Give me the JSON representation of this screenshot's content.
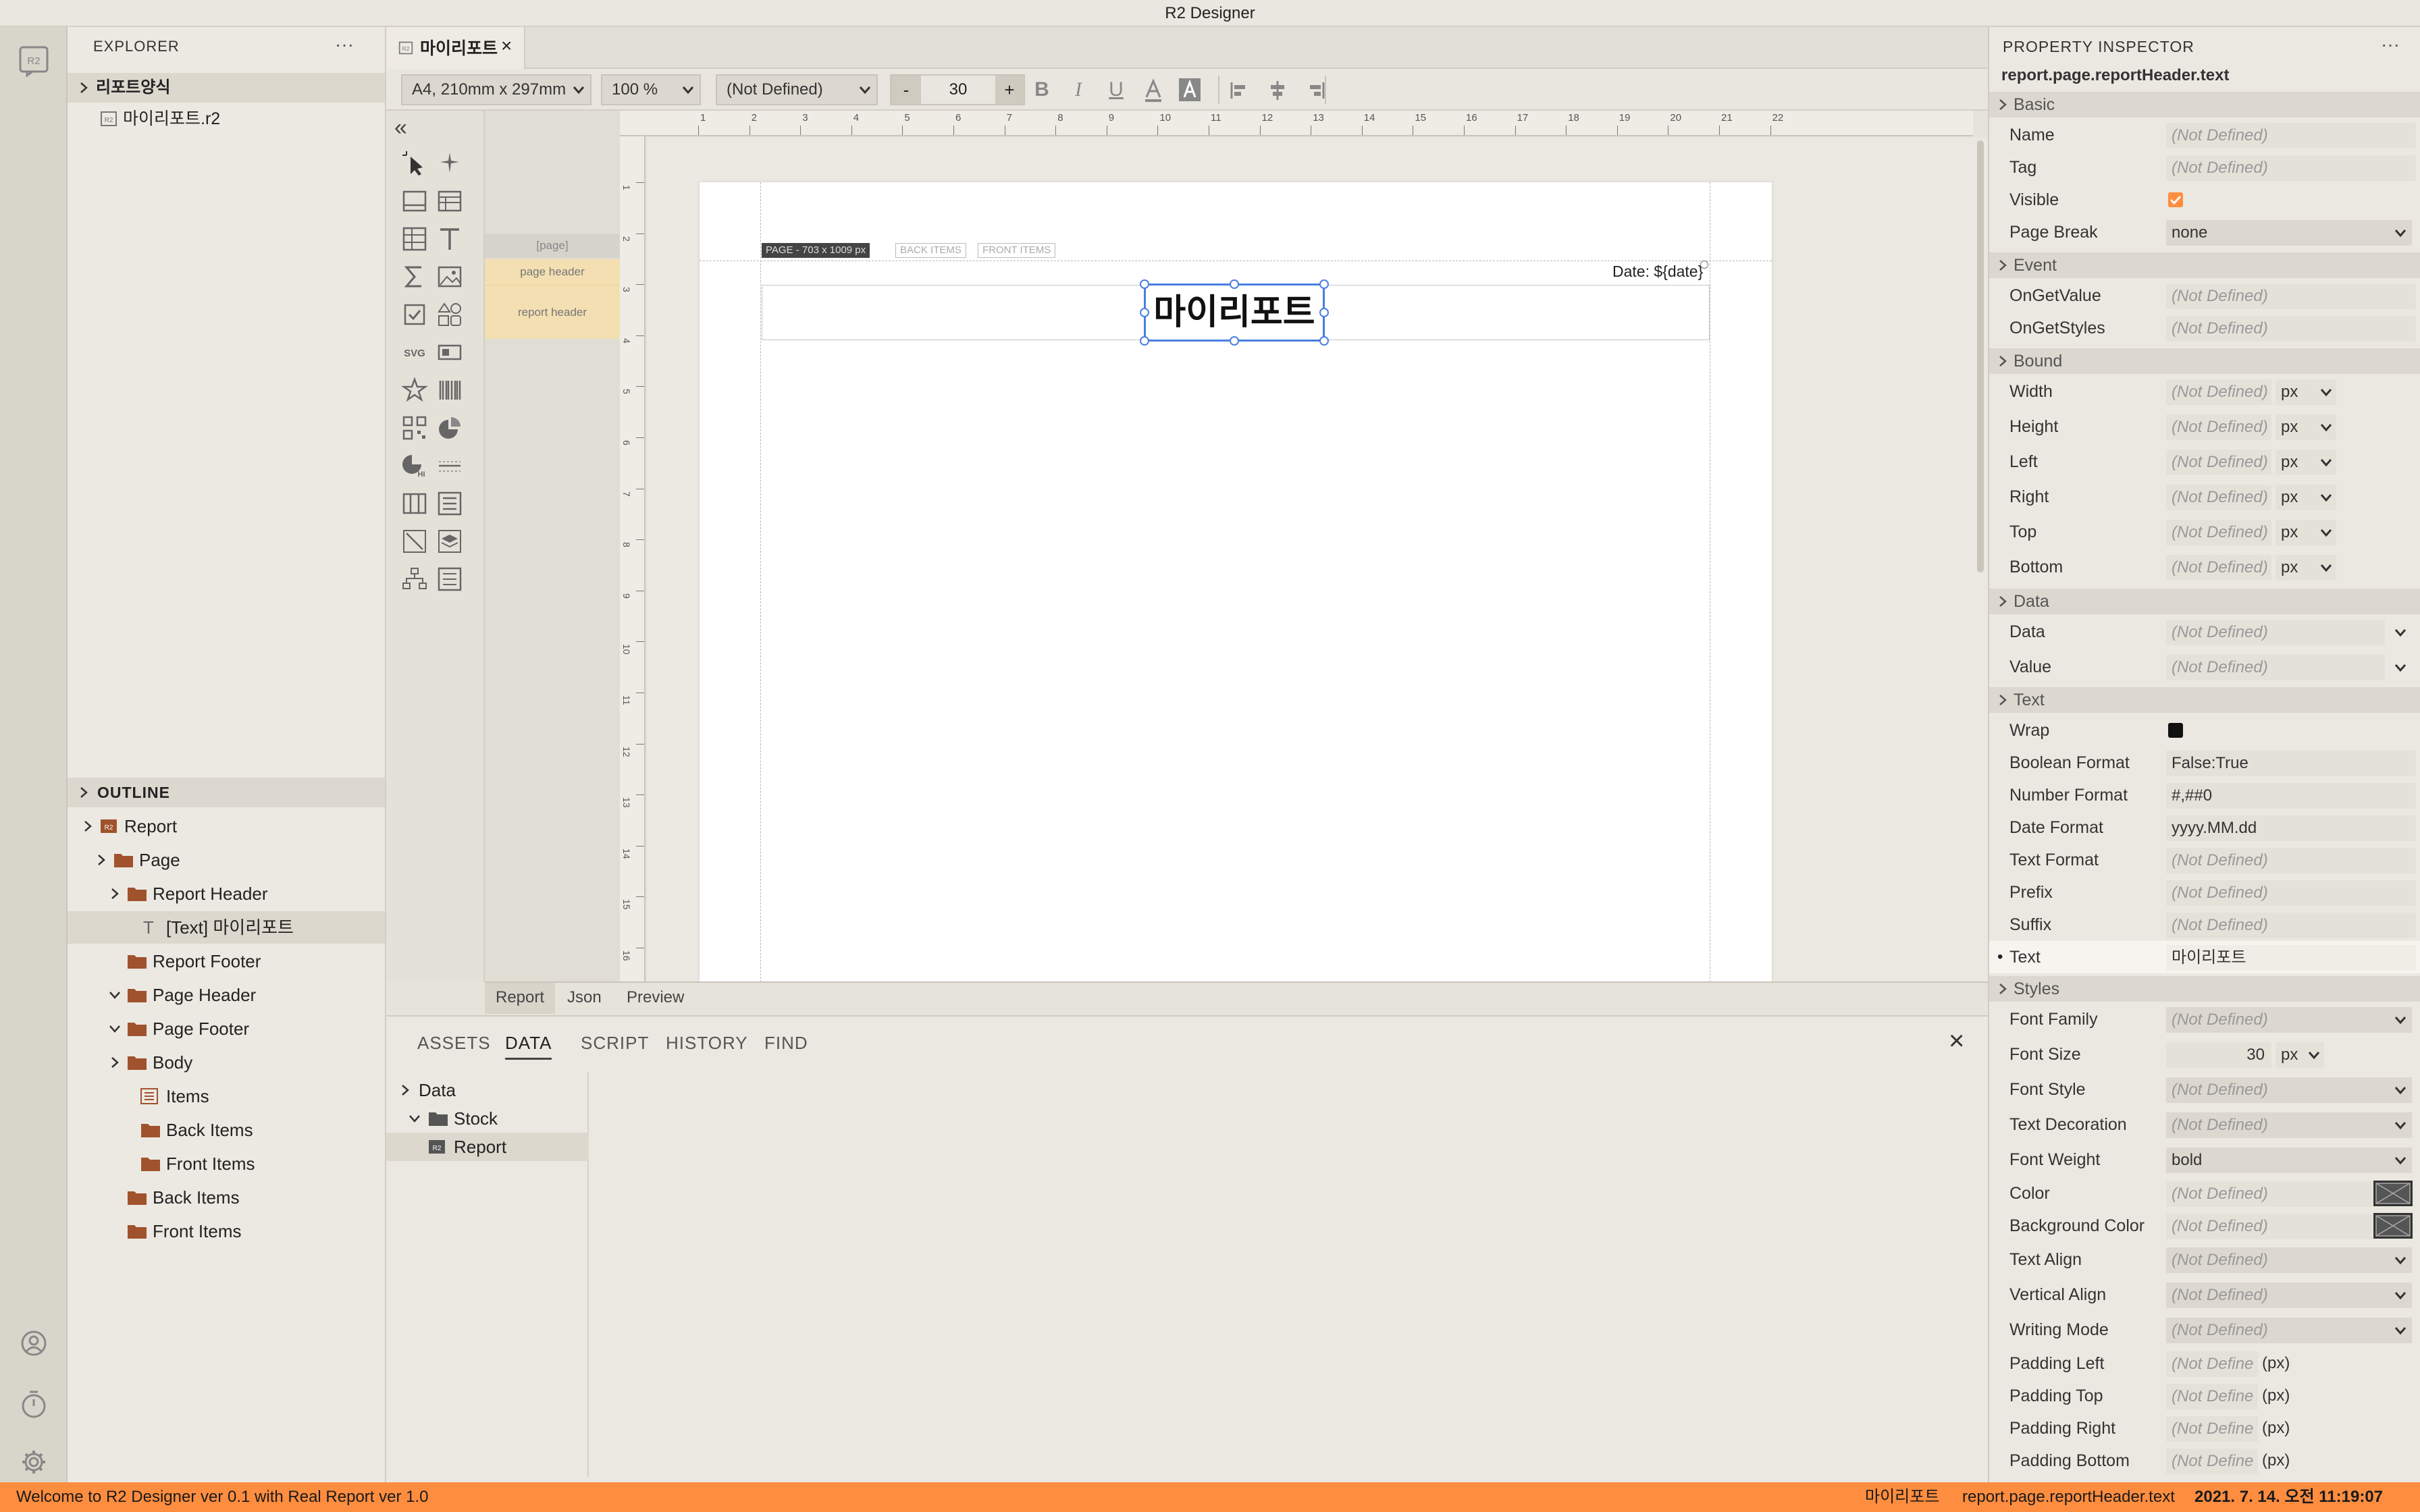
{
  "window": {
    "title": "R2 Designer"
  },
  "explorer": {
    "title": "EXPLORER",
    "more": "···",
    "folder": "리포트양식",
    "file": "마이리포트.r2"
  },
  "outline": {
    "title": "OUTLINE",
    "items": [
      {
        "label": "Report"
      },
      {
        "label": "Page"
      },
      {
        "label": "Report Header"
      },
      {
        "label": "[Text] 마이리포트"
      },
      {
        "label": "Report Footer"
      },
      {
        "label": "Page Header"
      },
      {
        "label": "Page Footer"
      },
      {
        "label": "Body"
      },
      {
        "label": "Items"
      },
      {
        "label": "Back Items"
      },
      {
        "label": "Front Items"
      },
      {
        "label": "Back Items"
      },
      {
        "label": "Front Items"
      }
    ]
  },
  "editor": {
    "tab_label": "마이리포트",
    "tab_close": "×",
    "collapse": "«"
  },
  "toolbar": {
    "paper": "A4, 210mm x 297mm",
    "zoom": "100 %",
    "font": "(Not Defined)",
    "minus": "-",
    "font_size": "30",
    "plus": "+",
    "bold": "B",
    "italic": "I",
    "underline": "U"
  },
  "bands": {
    "page": "[page]",
    "page_header": "page header",
    "report_header": "report header"
  },
  "ruler": {
    "h": [
      "1",
      "2",
      "3",
      "4",
      "5",
      "6",
      "7",
      "8",
      "9",
      "10",
      "11",
      "12",
      "13",
      "14",
      "15",
      "16",
      "17",
      "18",
      "19",
      "20",
      "21",
      "22"
    ],
    "v": [
      "1",
      "2",
      "3",
      "4",
      "5",
      "6",
      "7",
      "8",
      "9",
      "10",
      "11",
      "12",
      "13",
      "14",
      "15",
      "16"
    ]
  },
  "page": {
    "size_tag": "PAGE - 703 x 1009 px",
    "back_items": "BACK ITEMS",
    "front_items": "FRONT ITEMS",
    "date_text": "Date: ${date}",
    "report_title": "마이리포트"
  },
  "bottom_tabs": [
    "Report",
    "Json",
    "Preview"
  ],
  "panel": {
    "tabs": [
      "ASSETS",
      "DATA",
      "SCRIPT",
      "HISTORY",
      "FIND"
    ],
    "close": "×",
    "tree": [
      {
        "label": "Data"
      },
      {
        "label": "Stock"
      },
      {
        "label": "Report"
      }
    ]
  },
  "inspector": {
    "title": "PROPERTY INSPECTOR",
    "more": "···",
    "path": "report.page.reportHeader.text",
    "sections": {
      "basic": "Basic",
      "event": "Event",
      "bound": "Bound",
      "data": "Data",
      "text": "Text",
      "styles": "Styles"
    },
    "basic": [
      {
        "label": "Name",
        "value": "(Not Defined)"
      },
      {
        "label": "Tag",
        "value": "(Not Defined)"
      },
      {
        "label": "Visible",
        "checked": true
      },
      {
        "label": "Page Break",
        "value": "none"
      }
    ],
    "event": [
      {
        "label": "OnGetValue",
        "value": "(Not Defined)"
      },
      {
        "label": "OnGetStyles",
        "value": "(Not Defined)"
      }
    ],
    "bound": [
      {
        "label": "Width",
        "value": "(Not Defined)",
        "unit": "px"
      },
      {
        "label": "Height",
        "value": "(Not Defined)",
        "unit": "px"
      },
      {
        "label": "Left",
        "value": "(Not Defined)",
        "unit": "px"
      },
      {
        "label": "Right",
        "value": "(Not Defined)",
        "unit": "px"
      },
      {
        "label": "Top",
        "value": "(Not Defined)",
        "unit": "px"
      },
      {
        "label": "Bottom",
        "value": "(Not Defined)",
        "unit": "px"
      }
    ],
    "data": [
      {
        "label": "Data",
        "value": "(Not Defined)"
      },
      {
        "label": "Value",
        "value": "(Not Defined)"
      }
    ],
    "text": [
      {
        "label": "Wrap",
        "checked": false
      },
      {
        "label": "Boolean Format",
        "value": "False:True"
      },
      {
        "label": "Number Format",
        "value": "#,##0"
      },
      {
        "label": "Date Format",
        "value": "yyyy.MM.dd"
      },
      {
        "label": "Text Format",
        "value": "(Not Defined)"
      },
      {
        "label": "Prefix",
        "value": "(Not Defined)"
      },
      {
        "label": "Suffix",
        "value": "(Not Defined)"
      },
      {
        "label": "Text",
        "value": "마이리포트",
        "bullet": "•"
      }
    ],
    "styles": [
      {
        "label": "Font Family",
        "value": "(Not Defined)"
      },
      {
        "label": "Font Size",
        "value": "30",
        "unit": "px"
      },
      {
        "label": "Font Style",
        "value": "(Not Defined)"
      },
      {
        "label": "Text Decoration",
        "value": "(Not Defined)"
      },
      {
        "label": "Font Weight",
        "value": "bold"
      },
      {
        "label": "Color",
        "value": "(Not Defined)"
      },
      {
        "label": "Background Color",
        "value": "(Not Defined)"
      },
      {
        "label": "Text Align",
        "value": "(Not Defined)"
      },
      {
        "label": "Vertical Align",
        "value": "(Not Defined)"
      },
      {
        "label": "Writing Mode",
        "value": "(Not Defined)"
      },
      {
        "label": "Padding Left",
        "value": "(Not Define",
        "unit": "(px)"
      },
      {
        "label": "Padding Top",
        "value": "(Not Define",
        "unit": "(px)"
      },
      {
        "label": "Padding Right",
        "value": "(Not Define",
        "unit": "(px)"
      },
      {
        "label": "Padding Bottom",
        "value": "(Not Define",
        "unit": "(px)"
      }
    ]
  },
  "status": {
    "message": "Welcome to R2 Designer ver 0.1 with Real Report ver 1.0",
    "doc": "마이리포트",
    "path": "report.page.reportHeader.text",
    "time": "2021. 7. 14. 오전 11:19:07"
  },
  "colors": {
    "accent": "#ff8d3f",
    "folder": "#a0522d",
    "selection": "#4a7fe0",
    "band_highlight": "#f4dfb2"
  }
}
